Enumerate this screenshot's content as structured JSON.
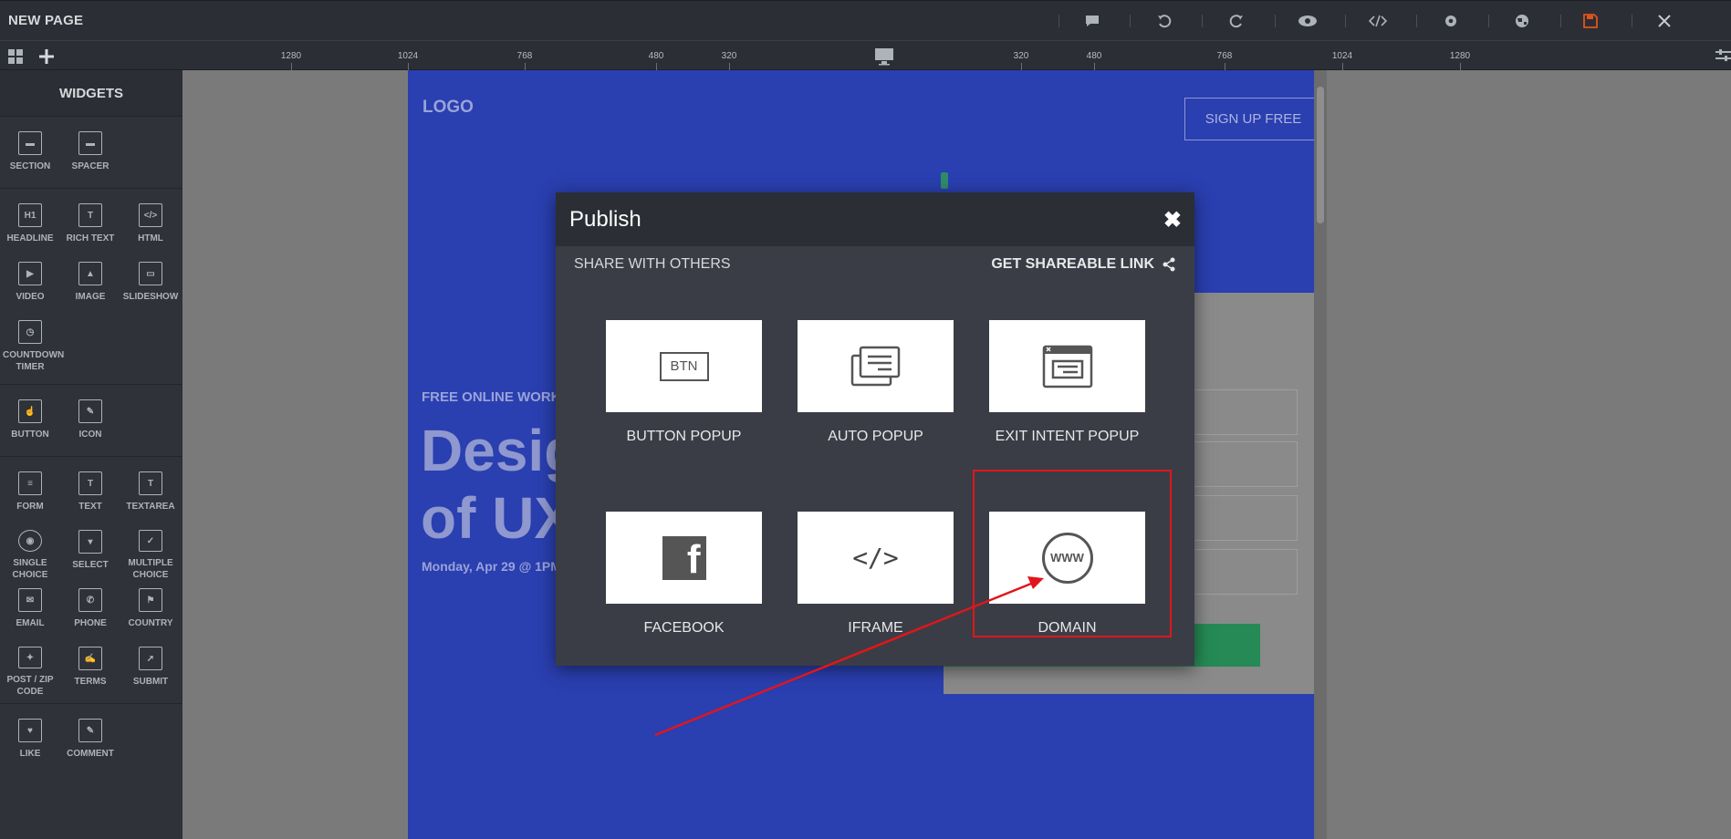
{
  "topbar": {
    "title": "NEW PAGE",
    "icons": [
      "comment-icon",
      "undo-icon",
      "redo-icon",
      "preview-icon",
      "code-icon",
      "settings-icon",
      "globe-icon",
      "save-icon",
      "close-icon"
    ],
    "save_color": "#e0541c"
  },
  "ruler": {
    "left_labels": [
      "1280",
      "1024",
      "768",
      "480",
      "320"
    ],
    "right_labels": [
      "320",
      "480",
      "768",
      "1024",
      "1280"
    ],
    "device": "desktop-icon"
  },
  "sidebar": {
    "title": "WIDGETS",
    "groups": [
      [
        {
          "label": "SECTION",
          "glyph": "▬"
        },
        {
          "label": "SPACER",
          "glyph": "▬"
        }
      ],
      [
        {
          "label": "HEADLINE",
          "glyph": "H1"
        },
        {
          "label": "RICH TEXT",
          "glyph": "T"
        },
        {
          "label": "HTML",
          "glyph": "</>"
        },
        {
          "label": "VIDEO",
          "glyph": "▶"
        },
        {
          "label": "IMAGE",
          "glyph": "▲"
        },
        {
          "label": "SLIDESHOW",
          "glyph": "▭"
        },
        {
          "label": "COUNTDOWN TIMER",
          "glyph": "◷"
        }
      ],
      [
        {
          "label": "BUTTON",
          "glyph": "☝"
        },
        {
          "label": "ICON",
          "glyph": "✎"
        }
      ],
      [
        {
          "label": "FORM",
          "glyph": "≡"
        },
        {
          "label": "TEXT",
          "glyph": "T"
        },
        {
          "label": "TEXTAREA",
          "glyph": "T"
        },
        {
          "label": "SINGLE CHOICE",
          "glyph": "◉"
        },
        {
          "label": "SELECT",
          "glyph": "▾"
        },
        {
          "label": "MULTIPLE CHOICE",
          "glyph": "✓"
        },
        {
          "label": "EMAIL",
          "glyph": "✉"
        },
        {
          "label": "PHONE",
          "glyph": "✆"
        },
        {
          "label": "COUNTRY",
          "glyph": "⚑"
        },
        {
          "label": "POST / ZIP CODE",
          "glyph": "✦"
        },
        {
          "label": "TERMS",
          "glyph": "✍"
        },
        {
          "label": "SUBMIT",
          "glyph": "➚"
        }
      ],
      [
        {
          "label": "LIKE",
          "glyph": "♥"
        },
        {
          "label": "COMMENT",
          "glyph": "✎"
        }
      ]
    ]
  },
  "page": {
    "logo": "LOGO",
    "signup": "SIGN UP FREE",
    "eyebrow": "FREE ONLINE WORK",
    "heading_line1": "Desig",
    "heading_line2": "of UX",
    "date": "Monday, Apr 29 @ 1PM",
    "bg_color": "#2a3fb0"
  },
  "modal": {
    "title": "Publish",
    "close": "✖",
    "share_label": "SHARE WITH OTHERS",
    "link_label": "GET SHAREABLE LINK",
    "options": [
      {
        "label": "BUTTON POPUP",
        "icon": "button-popup-icon",
        "glyph": "BTN"
      },
      {
        "label": "AUTO POPUP",
        "icon": "auto-popup-icon"
      },
      {
        "label": "EXIT INTENT POPUP",
        "icon": "exit-intent-popup-icon"
      },
      {
        "label": "FACEBOOK",
        "icon": "facebook-icon",
        "glyph": "f"
      },
      {
        "label": "IFRAME",
        "icon": "iframe-icon",
        "glyph": "</>"
      },
      {
        "label": "DOMAIN",
        "icon": "www-icon",
        "glyph": "WWW"
      }
    ],
    "highlight_color": "#e0161c"
  }
}
